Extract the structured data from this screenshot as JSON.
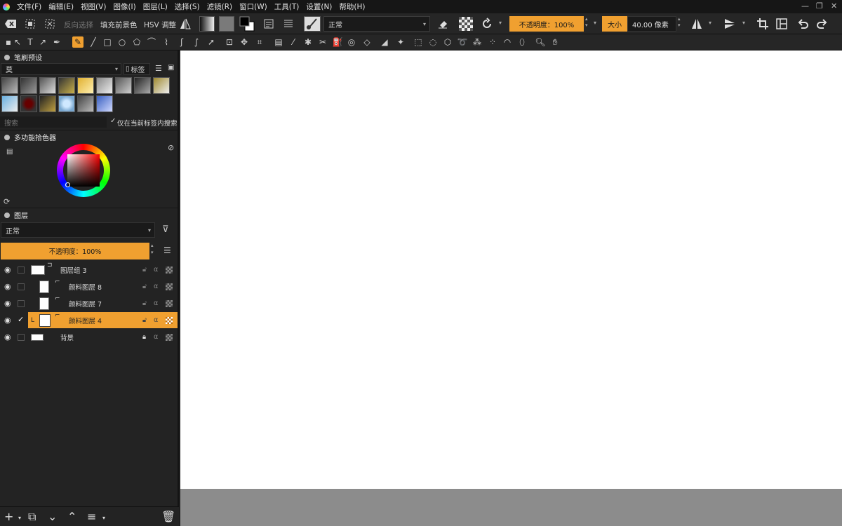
{
  "menubar": {
    "items": [
      "文件(F)",
      "编辑(E)",
      "视图(V)",
      "图像(I)",
      "图层(L)",
      "选择(S)",
      "滤镜(R)",
      "窗口(W)",
      "工具(T)",
      "设置(N)",
      "帮助(H)"
    ]
  },
  "toolbar": {
    "reverse_select": "反向选择",
    "fill_fg": "填充前景色",
    "hsv": "HSV 调整",
    "blend_mode": "正常",
    "opacity_label": "不透明度：100%",
    "size_label": "大小",
    "size_value": "40.00 像素"
  },
  "brush_panel": {
    "title": "笔刷预设",
    "preset_selected": "莫",
    "tag_button": "标签",
    "search_placeholder": "搜索",
    "search_in_tag": "仅在当前标签内搜索"
  },
  "color_panel": {
    "title": "多功能拾色器"
  },
  "layers_panel": {
    "title": "图层",
    "blend_mode": "正常",
    "opacity_label": "不透明度：100%",
    "layers": [
      {
        "name": "图层组 3"
      },
      {
        "name": "颜料图层 8"
      },
      {
        "name": "颜料图层 7"
      },
      {
        "name": "颜料图层 4"
      },
      {
        "name": "背景"
      }
    ]
  },
  "colors": {
    "accent": "#f0a030",
    "panel_bg": "#232323",
    "canvas_bg": "#ffffff"
  }
}
